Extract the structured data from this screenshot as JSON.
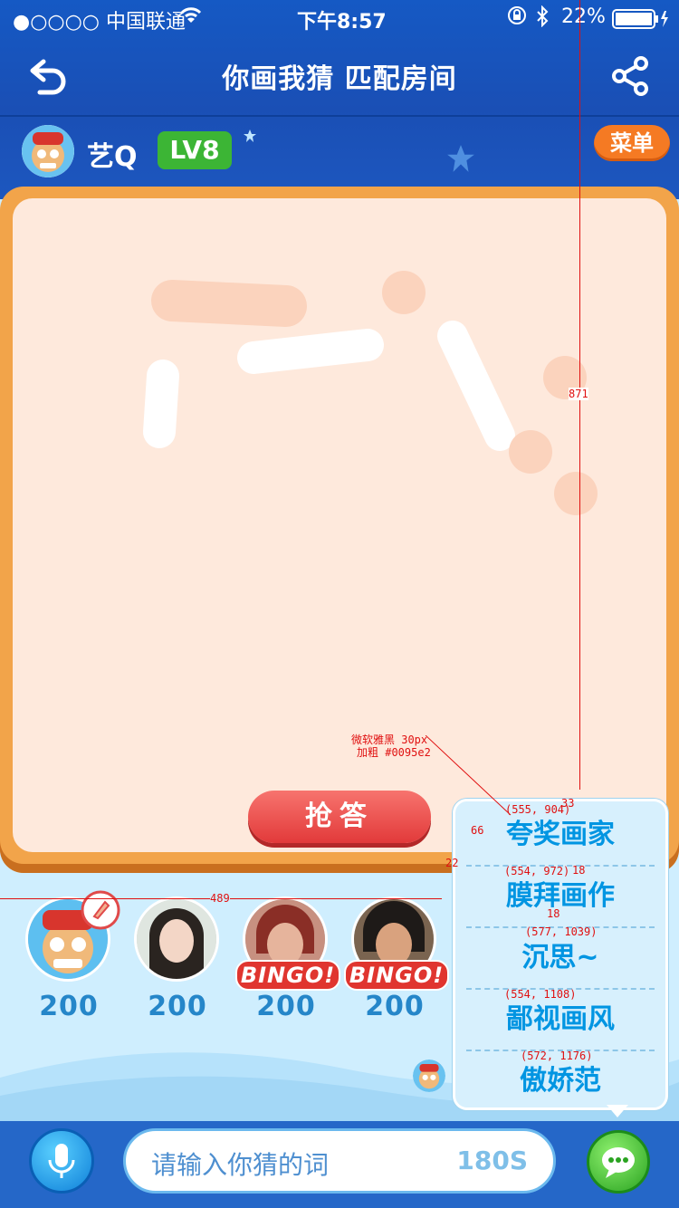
{
  "status": {
    "carrier": "●○○○○ 中国联通",
    "time": "下午8:57",
    "battery": "22%"
  },
  "nav": {
    "title": "你画我猜   匹配房间"
  },
  "user": {
    "name": "艺Q",
    "level": "LV8"
  },
  "menu_label": "菜单",
  "grab_label": "抢答",
  "players": [
    {
      "score": "200",
      "bingo": ""
    },
    {
      "score": "200",
      "bingo": ""
    },
    {
      "score": "200",
      "bingo": "BINGO!"
    },
    {
      "score": "200",
      "bingo": "BINGO!"
    }
  ],
  "quick_phrases": [
    "夸奖画家",
    "膜拜画作",
    "沉思~",
    "鄙视画风",
    "傲娇范"
  ],
  "input": {
    "placeholder": "请输入你猜的词",
    "timer": "180S"
  },
  "annotations": {
    "font_note_1": "微软雅黑 30px",
    "font_note_2": "加粗 #0095e2",
    "measure_871": "871",
    "measure_33": "33",
    "measure_66": "66",
    "measure_22": "22",
    "measure_18a": "18",
    "measure_18b": "18",
    "measure_489": "489",
    "coord_1": "(555, 904)",
    "coord_2": "(554, 972)",
    "coord_3": "(577, 1039)",
    "coord_4": "(554, 1108)",
    "coord_5": "(572, 1176)"
  },
  "colors": {
    "phrase_text": "#0095e2",
    "header_bg": "#1559c4",
    "level_badge": "#3cb535",
    "menu_button": "#f57a23",
    "grab_button": "#e23a3a"
  }
}
